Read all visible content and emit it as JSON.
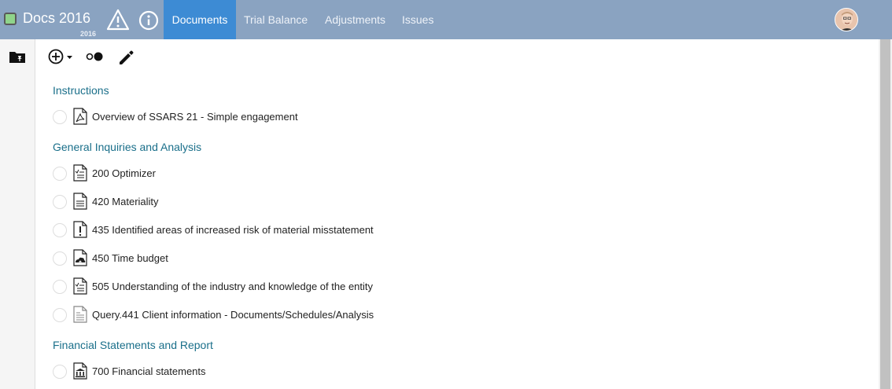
{
  "header": {
    "title": "Docs 2016",
    "year": "2016",
    "tabs": [
      {
        "label": "Documents",
        "active": true
      },
      {
        "label": "Trial Balance",
        "active": false
      },
      {
        "label": "Adjustments",
        "active": false
      },
      {
        "label": "Issues",
        "active": false
      }
    ],
    "status_color": "#8fd48a",
    "bar_color": "#8aa3c1",
    "active_tab_color": "#3d8bd4"
  },
  "toolbar": {
    "icons": [
      "add-circle-icon",
      "dropdown-caret-icon",
      "toggle-dots-icon",
      "pencil-icon"
    ]
  },
  "sections": [
    {
      "heading": "Instructions",
      "docs": [
        {
          "label": "Overview of SSARS 21 - Simple engagement",
          "icon": "pdf-icon"
        }
      ]
    },
    {
      "heading": "General Inquiries and Analysis",
      "docs": [
        {
          "label": "200 Optimizer",
          "icon": "checklist-doc-icon"
        },
        {
          "label": "420 Materiality",
          "icon": "text-doc-icon"
        },
        {
          "label": "435 Identified areas of increased risk of material misstatement",
          "icon": "risk-doc-icon"
        },
        {
          "label": "450 Time budget",
          "icon": "budget-doc-icon"
        },
        {
          "label": "505 Understanding of the industry and knowledge of the entity",
          "icon": "checklist-doc-icon"
        },
        {
          "label": "Query.441 Client information - Documents/Schedules/Analysis",
          "icon": "query-doc-icon"
        }
      ]
    },
    {
      "heading": "Financial Statements and Report",
      "docs": [
        {
          "label": "700 Financial statements",
          "icon": "statements-doc-icon"
        }
      ]
    }
  ],
  "colors": {
    "heading": "#1a6f8a",
    "text": "#222222"
  }
}
